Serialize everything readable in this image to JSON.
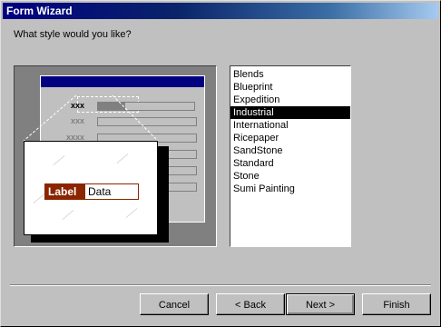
{
  "window": {
    "title": "Form Wizard"
  },
  "prompt": "What style would you like?",
  "preview": {
    "field_labels": [
      "xxx",
      "xxx",
      "xxxx",
      "xxx"
    ],
    "zoom_label": "Label",
    "zoom_data": "Data",
    "colors": {
      "form_bar": "#000080",
      "label_bg": "#8b2500"
    }
  },
  "styles": {
    "items": [
      "Blends",
      "Blueprint",
      "Expedition",
      "Industrial",
      "International",
      "Ricepaper",
      "SandStone",
      "Standard",
      "Stone",
      "Sumi Painting"
    ],
    "selected": "Industrial"
  },
  "buttons": {
    "cancel": "Cancel",
    "back": "< Back",
    "next": "Next >",
    "finish": "Finish"
  }
}
